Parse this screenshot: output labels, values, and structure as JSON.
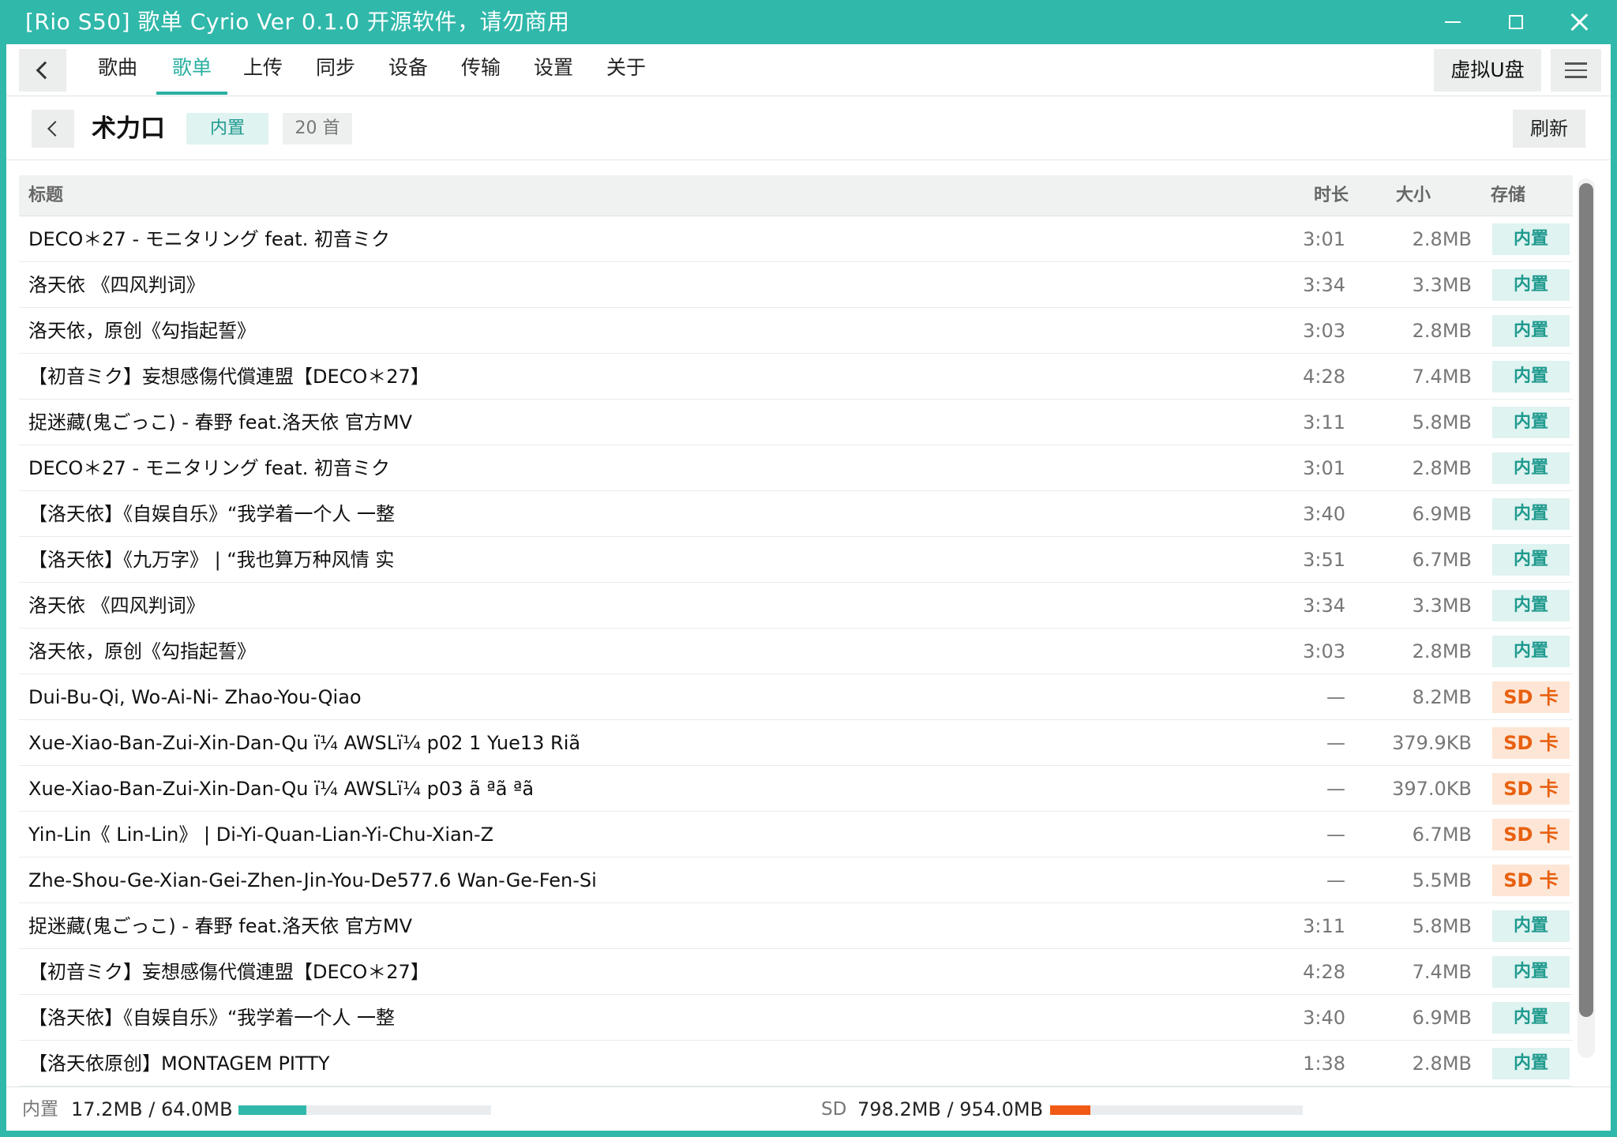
{
  "window": {
    "title": "[Rio S50] 歌单 Cyrio Ver 0.1.0 开源软件，请勿商用"
  },
  "nav": {
    "tabs": [
      {
        "label": "歌曲",
        "active": false
      },
      {
        "label": "歌单",
        "active": true
      },
      {
        "label": "上传",
        "active": false
      },
      {
        "label": "同步",
        "active": false
      },
      {
        "label": "设备",
        "active": false
      },
      {
        "label": "传输",
        "active": false
      },
      {
        "label": "设置",
        "active": false
      },
      {
        "label": "关于",
        "active": false
      }
    ],
    "usb_button": "虚拟U盘"
  },
  "playlist": {
    "name": "术力口",
    "storage_badge": "内置",
    "count": "20 首",
    "refresh_label": "刷新"
  },
  "table": {
    "headers": {
      "title": "标题",
      "duration": "时长",
      "size": "大小",
      "storage": "存储"
    },
    "rows": [
      {
        "title": "DECO＊27 - モニタリング feat. 初音ミク",
        "duration": "3:01",
        "size": "2.8MB",
        "storage": "内置",
        "storage_type": "internal"
      },
      {
        "title": "洛天依 《四风判词》",
        "duration": "3:34",
        "size": "3.3MB",
        "storage": "内置",
        "storage_type": "internal"
      },
      {
        "title": "洛天依，原创《勾指起誓》",
        "duration": "3:03",
        "size": "2.8MB",
        "storage": "内置",
        "storage_type": "internal"
      },
      {
        "title": "【初音ミク】妄想感傷代償連盟【DECO＊27】",
        "duration": "4:28",
        "size": "7.4MB",
        "storage": "内置",
        "storage_type": "internal"
      },
      {
        "title": "捉迷藏(鬼ごっこ) - 春野 feat.洛天依 官方MV",
        "duration": "3:11",
        "size": "5.8MB",
        "storage": "内置",
        "storage_type": "internal"
      },
      {
        "title": "DECO＊27 - モニタリング feat. 初音ミク",
        "duration": "3:01",
        "size": "2.8MB",
        "storage": "内置",
        "storage_type": "internal"
      },
      {
        "title": "【洛天依】《自娱自乐》“我学着一个人 一整",
        "duration": "3:40",
        "size": "6.9MB",
        "storage": "内置",
        "storage_type": "internal"
      },
      {
        "title": "【洛天依】《九万字》 | “我也算万种风情 实",
        "duration": "3:51",
        "size": "6.7MB",
        "storage": "内置",
        "storage_type": "internal"
      },
      {
        "title": "洛天依 《四风判词》",
        "duration": "3:34",
        "size": "3.3MB",
        "storage": "内置",
        "storage_type": "internal"
      },
      {
        "title": "洛天依，原创《勾指起誓》",
        "duration": "3:03",
        "size": "2.8MB",
        "storage": "内置",
        "storage_type": "internal"
      },
      {
        "title": "Dui-Bu-Qi, Wo-Ai-Ni- Zhao-You-Qiao",
        "duration": "—",
        "size": "8.2MB",
        "storage": "SD 卡",
        "storage_type": "sd"
      },
      {
        "title": "Xue-Xiao-Ban-Zui-Xin-Dan-Qu ï¼ AWSLï¼ p02 1 Yue13 Riã",
        "duration": "—",
        "size": "379.9KB",
        "storage": "SD 卡",
        "storage_type": "sd"
      },
      {
        "title": "Xue-Xiao-Ban-Zui-Xin-Dan-Qu ï¼ AWSLï¼ p03 ã ªã ªã",
        "duration": "—",
        "size": "397.0KB",
        "storage": "SD 卡",
        "storage_type": "sd"
      },
      {
        "title": "Yin-Lin《 Lin-Lin》 | Di-Yi-Quan-Lian-Yi-Chu-Xian-Z",
        "duration": "—",
        "size": "6.7MB",
        "storage": "SD 卡",
        "storage_type": "sd"
      },
      {
        "title": "Zhe-Shou-Ge-Xian-Gei-Zhen-Jin-You-De577.6 Wan-Ge-Fen-Si",
        "duration": "—",
        "size": "5.5MB",
        "storage": "SD 卡",
        "storage_type": "sd"
      },
      {
        "title": "捉迷藏(鬼ごっこ) - 春野 feat.洛天依 官方MV",
        "duration": "3:11",
        "size": "5.8MB",
        "storage": "内置",
        "storage_type": "internal"
      },
      {
        "title": "【初音ミク】妄想感傷代償連盟【DECO＊27】",
        "duration": "4:28",
        "size": "7.4MB",
        "storage": "内置",
        "storage_type": "internal"
      },
      {
        "title": "【洛天依】《自娱自乐》“我学着一个人 一整",
        "duration": "3:40",
        "size": "6.9MB",
        "storage": "内置",
        "storage_type": "internal"
      },
      {
        "title": "【洛天依原创】MONTAGEM PITTY",
        "duration": "1:38",
        "size": "2.8MB",
        "storage": "内置",
        "storage_type": "internal"
      }
    ]
  },
  "status": {
    "internal_label": "内置",
    "internal_value": "17.2MB / 64.0MB",
    "internal_fraction": 0.27,
    "sd_label": "SD",
    "sd_value": "798.2MB / 954.0MB",
    "sd_fraction": 0.16
  },
  "colors": {
    "accent": "#30b8aa",
    "internal_bar": "#30b8aa",
    "sd_bar": "#f05a14"
  },
  "icons": {
    "back": "chevron-left-icon",
    "menu": "hamburger-icon",
    "minimize": "minimize-icon",
    "maximize": "maximize-icon",
    "close": "close-icon"
  }
}
